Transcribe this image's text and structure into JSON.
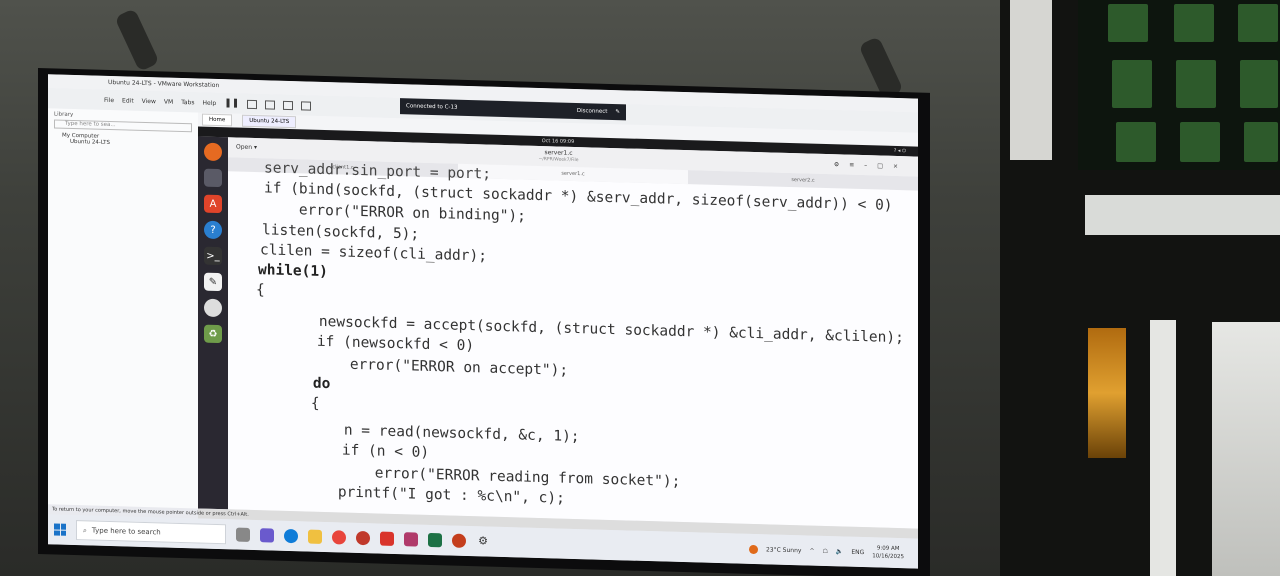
{
  "vmware": {
    "title": "Ubuntu 24-LTS - VMware Workstation",
    "menu": [
      "File",
      "Edit",
      "View",
      "VM",
      "Tabs",
      "Help"
    ],
    "connection": {
      "label": "Connected to C-13",
      "disconnect": "Disconnect"
    },
    "library": {
      "header": "Library",
      "search_placeholder": "Type here to sea...",
      "tree": [
        "My Computer",
        "Ubuntu 24-LTS"
      ]
    },
    "tabs": [
      "Home",
      "Ubuntu 24-LTS"
    ],
    "status_tip": "To return to your computer, move the mouse pointer outside or press Ctrl+Alt."
  },
  "ubuntu": {
    "clock": "Oct 16  09:09",
    "gedit": {
      "open_label": "Open",
      "file_name": "server1.c",
      "file_path": "~/RPR/Week7/File",
      "tabs": [
        "client1.c",
        "server1.c",
        "server2.c"
      ],
      "selected_tab": "server1.c"
    },
    "code_lines": [
      "serv_addr.sin_port = port;",
      "if (bind(sockfd, (struct sockaddr *) &serv_addr, sizeof(serv_addr)) < 0)",
      "    error(\"ERROR on binding\");",
      "listen(sockfd, 5);",
      "clilen = sizeof(cli_addr);",
      "while(1)",
      "{",
      "    newsockfd = accept(sockfd, (struct sockaddr *) &cli_addr, &clilen);",
      "    if (newsockfd < 0)",
      "        error(\"ERROR on accept\");",
      "    do",
      "    {",
      "        n = read(newsockfd, &c, 1);",
      "        if (n < 0)",
      "            error(\"ERROR reading from socket\");",
      "        printf(\"I got : %c\\n\", c);"
    ]
  },
  "windows_taskbar": {
    "search_placeholder": "Type here to search",
    "weather": "23°C  Sunny",
    "language": "ENG",
    "time": "9:09 AM",
    "date": "10/16/2025"
  },
  "colors": {
    "weather_icon": "#e06a1a",
    "windows_blue": "#1a73c8",
    "ubuntu_dock": "#2a2831"
  }
}
